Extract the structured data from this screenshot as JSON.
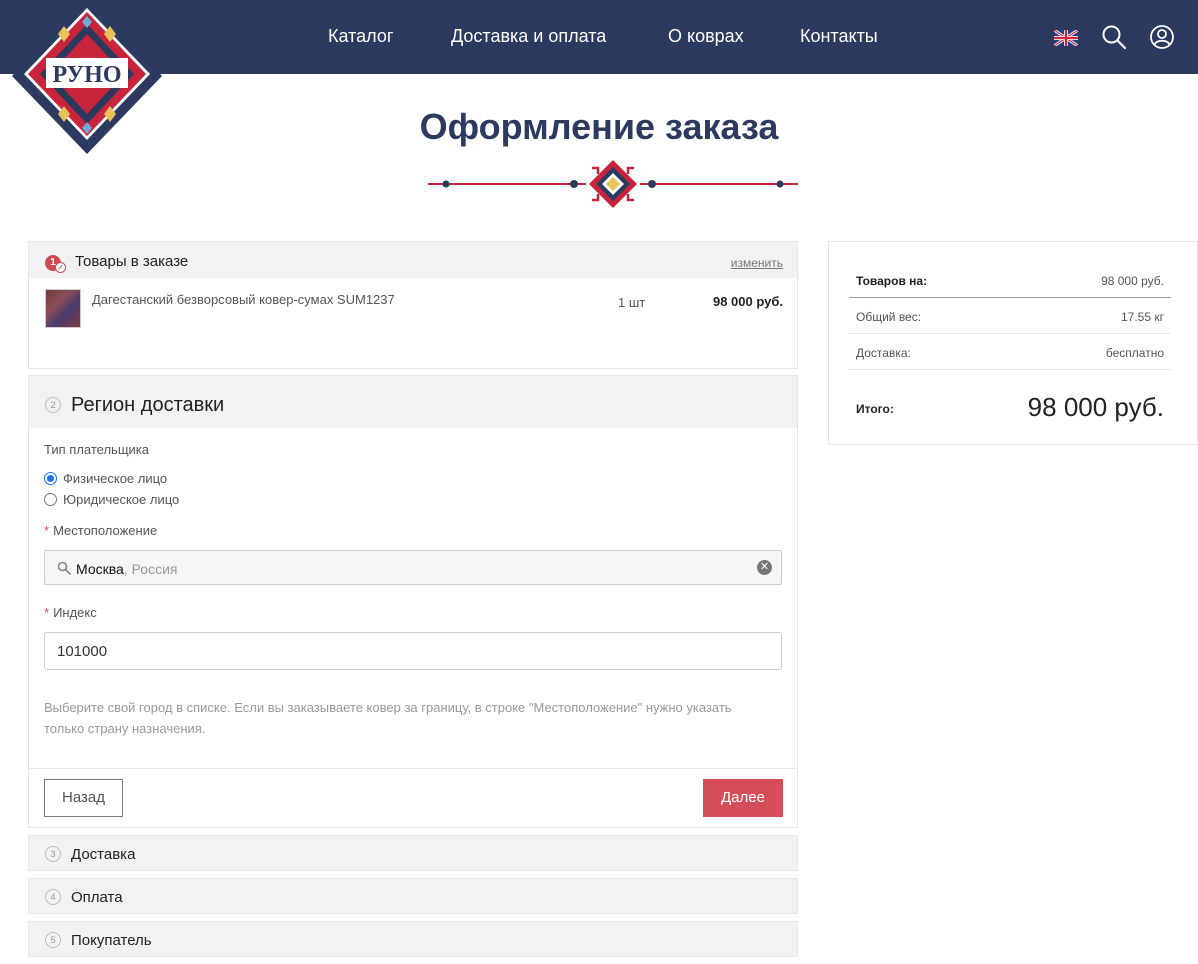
{
  "header": {
    "logo_text": "РУНО",
    "nav": [
      "Каталог",
      "Доставка и оплата",
      "О коврах",
      "Контакты"
    ]
  },
  "page": {
    "title": "Оформление заказа"
  },
  "order_items": {
    "step": "1",
    "title": "Товары в заказе",
    "change_label": "изменить",
    "item": {
      "name": "Дагестанский безворсовый ковер-сумах SUM1237",
      "qty": "1 шт",
      "price": "98 000 руб."
    }
  },
  "region": {
    "step": "2",
    "title": "Регион доставки",
    "payer_type_label": "Тип плательщика",
    "payer_options": [
      {
        "label": "Физическое лицо",
        "selected": true
      },
      {
        "label": "Юридическое лицо",
        "selected": false
      }
    ],
    "location_label": "Местоположение",
    "location_city": "Москва",
    "location_country": ", Россия",
    "index_label": "Индекс",
    "index_value": "101000",
    "required_mark": "*",
    "hint": "Выберите свой город в списке. Если вы заказываете ковер за границу, в строке \"Местоположение\" нужно указать только страну назначения.",
    "back_label": "Назад",
    "next_label": "Далее"
  },
  "steps": [
    {
      "num": "3",
      "title": "Доставка"
    },
    {
      "num": "4",
      "title": "Оплата"
    },
    {
      "num": "5",
      "title": "Покупатель"
    }
  ],
  "summary": {
    "goods_label": "Товаров на:",
    "goods_value": "98 000 руб.",
    "weight_label": "Общий вес:",
    "weight_value": "17.55 кг",
    "delivery_label": "Доставка:",
    "delivery_value": "бесплатно",
    "total_label": "Итого:",
    "total_value": "98 000 руб."
  },
  "colors": {
    "header_bg": "#2b3a5e",
    "accent": "#d64d5a",
    "title": "#2b3a5e"
  }
}
